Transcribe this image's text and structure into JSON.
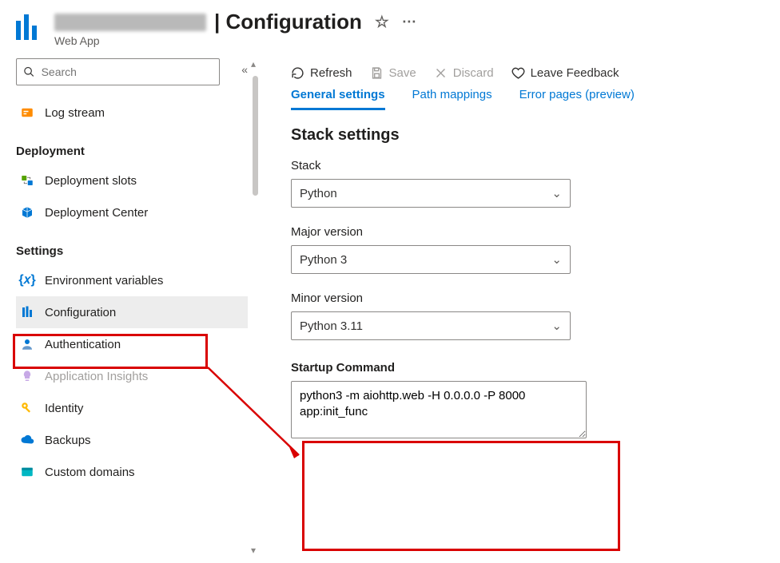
{
  "header": {
    "title_suffix": "| Configuration",
    "subtitle": "Web App",
    "star_title": "Pin",
    "more_title": "More"
  },
  "search": {
    "placeholder": "Search"
  },
  "collapse_tooltip": "Collapse",
  "sidebar": {
    "top_items": [
      {
        "label": "Log stream",
        "icon": "log-stream"
      }
    ],
    "sections": [
      {
        "title": "Deployment",
        "items": [
          {
            "label": "Deployment slots",
            "icon": "slots"
          },
          {
            "label": "Deployment Center",
            "icon": "box"
          }
        ]
      },
      {
        "title": "Settings",
        "items": [
          {
            "label": "Environment variables",
            "icon": "braces"
          },
          {
            "label": "Configuration",
            "icon": "config",
            "selected": true
          },
          {
            "label": "Authentication",
            "icon": "person"
          },
          {
            "label": "Application Insights",
            "icon": "bulb",
            "disabled": true
          },
          {
            "label": "Identity",
            "icon": "key"
          },
          {
            "label": "Backups",
            "icon": "cloud"
          },
          {
            "label": "Custom domains",
            "icon": "domain"
          }
        ]
      }
    ]
  },
  "commands": {
    "refresh": "Refresh",
    "save": "Save",
    "discard": "Discard",
    "feedback": "Leave Feedback"
  },
  "tabs": {
    "general": "General settings",
    "path": "Path mappings",
    "errors": "Error pages (preview)"
  },
  "main": {
    "section_title": "Stack settings",
    "stack": {
      "label": "Stack",
      "value": "Python"
    },
    "major": {
      "label": "Major version",
      "value": "Python 3"
    },
    "minor": {
      "label": "Minor version",
      "value": "Python 3.11"
    },
    "startup": {
      "label": "Startup Command",
      "value": "python3 -m aiohttp.web -H 0.0.0.0 -P 8000 app:init_func"
    }
  }
}
